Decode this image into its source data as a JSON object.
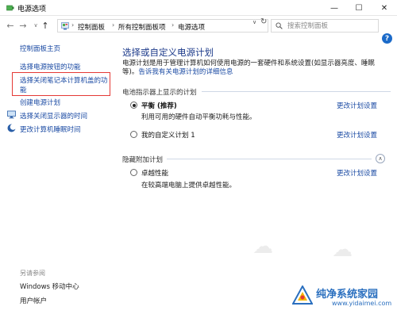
{
  "window": {
    "title": "电源选项",
    "minimize_glyph": "—",
    "maximize_glyph": "☐",
    "close_glyph": "✕"
  },
  "addressbar": {
    "back_glyph": "←",
    "forward_glyph": "→",
    "dropdown_glyph": "∨",
    "up_glyph": "↑",
    "crumbs": [
      "控制面板",
      "所有控制面板项",
      "电源选项"
    ],
    "crumb_separator": "›",
    "crumb_dropdown_glyph": "∨",
    "refresh_glyph": "↻",
    "search_placeholder": "搜索控制面板"
  },
  "help": {
    "label": "?"
  },
  "sidebar": {
    "home_label": "控制面板主页",
    "items": [
      {
        "label": "选择电源按钮的功能",
        "icon": ""
      },
      {
        "label": "选择关闭笔记本计算机盖的功能",
        "icon": ""
      },
      {
        "label": "创建电源计划",
        "icon": ""
      },
      {
        "label": "选择关闭显示器的时间",
        "icon": "monitor-icon"
      },
      {
        "label": "更改计算机睡眠时间",
        "icon": "moon-icon"
      }
    ],
    "see_also_label": "另请参阅",
    "see_also": [
      {
        "label": "Windows 移动中心"
      },
      {
        "label": "用户帐户"
      }
    ]
  },
  "main": {
    "title": "选择或自定义电源计划",
    "description": "电源计划是用于管理计算机如何使用电源的一套硬件和系统设置(如显示器亮度、睡眠等)。",
    "description_link": "告诉我有关电源计划的详细信息",
    "battery_section": "电池指示器上显示的计划",
    "hidden_section": "隐藏附加计划",
    "collapse_glyph": "∧",
    "plans": [
      {
        "name": "平衡 (推荐)",
        "desc": "利用可用的硬件自动平衡功耗与性能。",
        "link": "更改计划设置",
        "selected": true
      },
      {
        "name": "我的自定义计划 1",
        "desc": "",
        "link": "更改计划设置",
        "selected": false
      },
      {
        "name": "卓越性能",
        "desc": "在较高端电脑上提供卓越性能。",
        "link": "更改计划设置",
        "selected": false
      }
    ]
  },
  "watermark": {
    "title": "纯净系统家园",
    "url": "www.yidaimei.com"
  },
  "colors": {
    "link": "#1a4aa3",
    "title": "#1c3a8a",
    "highlight": "#e53935",
    "help": "#1b6ac9"
  }
}
